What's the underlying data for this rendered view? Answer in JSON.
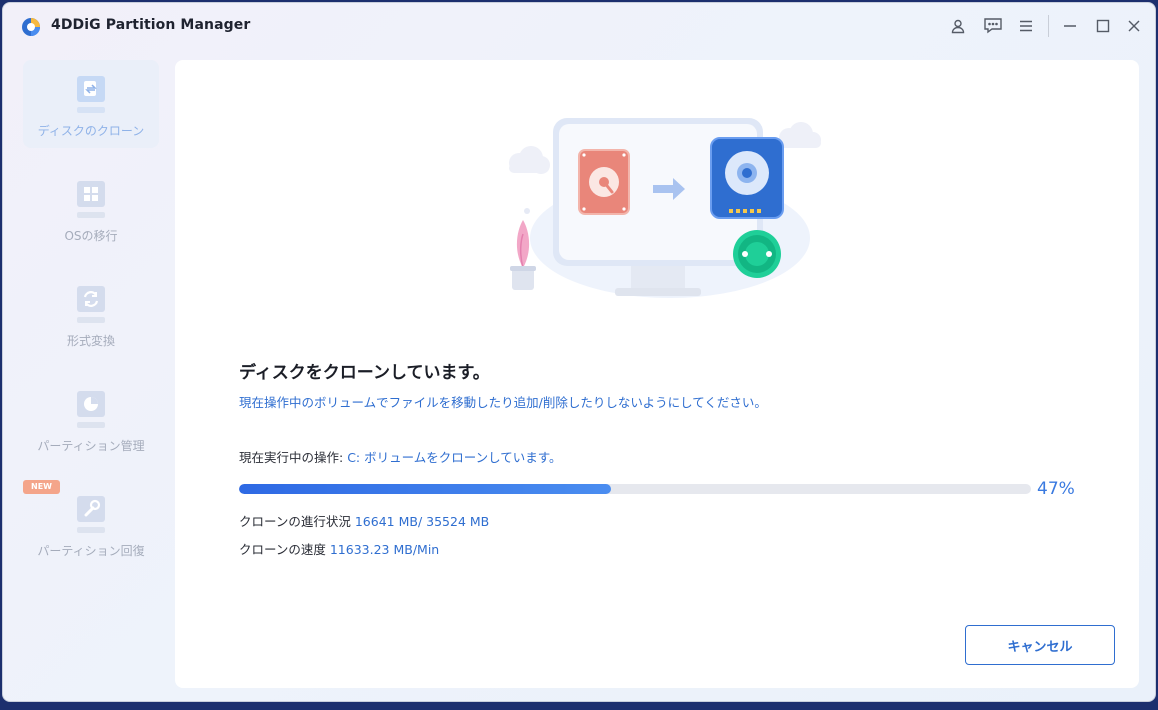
{
  "app": {
    "title": "4DDiG Partition Manager"
  },
  "titlebar": {
    "icons": [
      "user-icon",
      "feedback-icon",
      "menu-icon",
      "minimize-icon",
      "maximize-icon",
      "close-icon"
    ]
  },
  "sidebar": {
    "items": [
      {
        "label": "ディスクのクローン",
        "icon": "disk-clone-icon",
        "active": true
      },
      {
        "label": "OSの移行",
        "icon": "os-migrate-icon",
        "active": false
      },
      {
        "label": "形式変換",
        "icon": "format-convert-icon",
        "active": false
      },
      {
        "label": "パーティション管理",
        "icon": "partition-manage-icon",
        "active": false
      },
      {
        "label": "パーティション回復",
        "icon": "partition-recovery-icon",
        "active": false,
        "badge": "NEW"
      }
    ]
  },
  "main": {
    "heading": "ディスクをクローンしています。",
    "warning": "現在操作中のボリュームでファイルを移動したり追加/削除したりしないようにしてください。",
    "current_op_label": "現在実行中の操作: ",
    "current_op_value": "C: ボリュームをクローンしています。",
    "progress_fraction": 0.47,
    "progress_text": "47%",
    "clone_progress_label": "クローンの進行状況 ",
    "clone_progress_value": "16641 MB/ 35524 MB",
    "clone_speed_label": "クローンの速度 ",
    "clone_speed_value": "11633.23 MB/Min",
    "cancel_label": "キャンセル"
  },
  "colors": {
    "accent": "#2f6ed0",
    "progress": "#2e69e4",
    "badge": "#f4a58a",
    "sidebar_text": "#a5acbb"
  }
}
